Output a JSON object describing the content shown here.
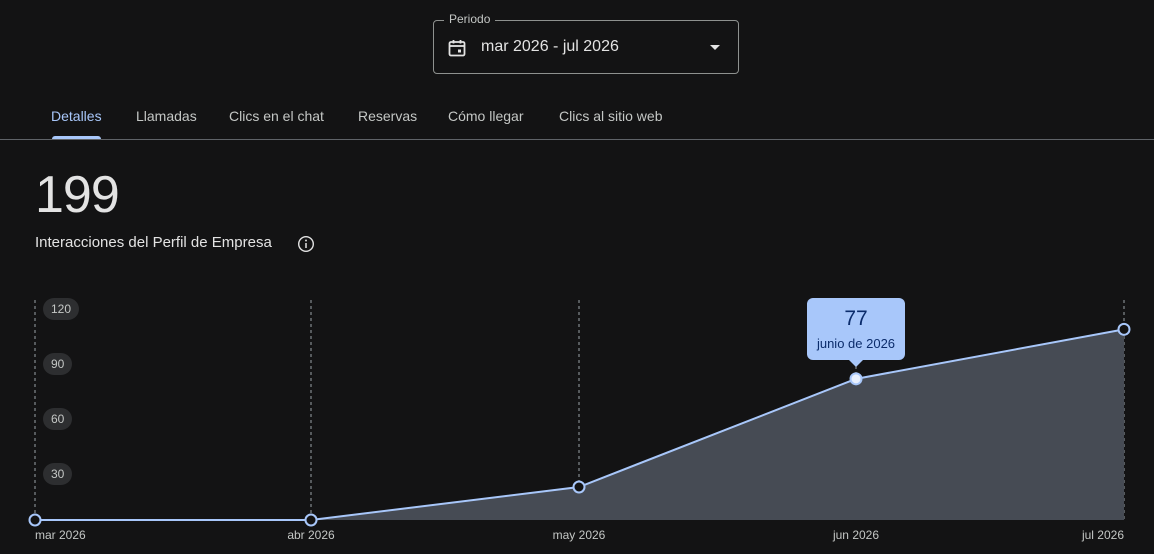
{
  "period": {
    "label": "Periodo",
    "value": "mar 2026 - jul 2026",
    "icon": "calendar-icon"
  },
  "tabs": [
    {
      "label": "Detalles",
      "active": true
    },
    {
      "label": "Llamadas",
      "active": false
    },
    {
      "label": "Clics en el chat",
      "active": false
    },
    {
      "label": "Reservas",
      "active": false
    },
    {
      "label": "Cómo llegar",
      "active": false
    },
    {
      "label": "Clics al sitio web",
      "active": false
    }
  ],
  "summary": {
    "total": "199",
    "label": "Interacciones del Perfil de Empresa",
    "info_icon": "info-icon"
  },
  "tooltip": {
    "value": "77",
    "date": "junio de 2026"
  },
  "colors": {
    "accent": "#a8c7fa",
    "area_fill": "#464b54",
    "background": "#131314"
  },
  "chart_data": {
    "type": "area",
    "categories": [
      "mar 2026",
      "abr 2026",
      "may 2026",
      "jun 2026",
      "jul 2026"
    ],
    "values": [
      0,
      0,
      18,
      77,
      104
    ],
    "yticks": [
      "30",
      "60",
      "90",
      "120"
    ],
    "ylim": [
      0,
      120
    ],
    "grid": "vertical-dashed",
    "highlighted_point": "jun 2026"
  }
}
